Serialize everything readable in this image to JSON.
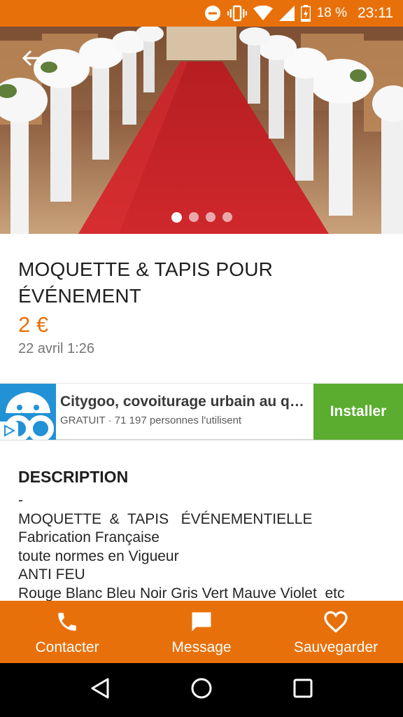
{
  "status_bar": {
    "battery": "18 %",
    "time": "23:11",
    "icons": [
      "do-not-disturb-icon",
      "vibrate-icon",
      "wifi-icon",
      "signal-icon",
      "battery-charging-icon"
    ]
  },
  "gallery": {
    "image": "red-carpet-event-photo",
    "image_count": 4,
    "active_index": 0
  },
  "listing": {
    "title": "MOQUETTE & TAPIS POUR ÉVÉNEMENT",
    "price": "2 €",
    "date": "22 avril 1:26"
  },
  "ad": {
    "title": "Citygoo, covoiturage urbain au qu…",
    "subtitle": "GRATUIT · 71 197 personnes l'utilisent",
    "install_label": "Installer",
    "logo": "citygoo-logo",
    "colors": {
      "logo_bg": "#2192d6",
      "install_bg": "#5aad2e"
    }
  },
  "description": {
    "heading": "DESCRIPTION",
    "body": "-\nMOQUETTE  &  TAPIS   ÉVÉNEMENTIELLE\nFabrication Française\ntoute normes en Vigueur\nANTI FEU\nRouge Blanc Bleu Noir Gris Vert Mauve Violet  etc"
  },
  "actions": {
    "contact_label": "Contacter",
    "message_label": "Message",
    "save_label": "Sauvegarder"
  },
  "theme": {
    "accent": "#e8700a",
    "text": "#1e1e1e",
    "muted": "#757575"
  }
}
